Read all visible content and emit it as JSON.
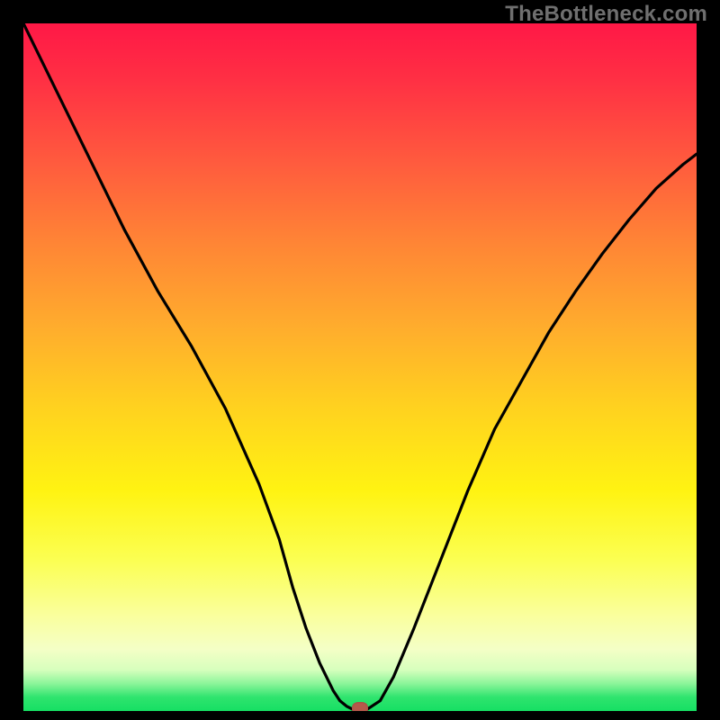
{
  "watermark": {
    "text": "TheBottleneck.com"
  },
  "colors": {
    "background": "#000000",
    "curve_stroke": "#000000",
    "marker_fill": "#b6594b",
    "gradient_top": "#ff1846",
    "gradient_bottom": "#16df63"
  },
  "chart_data": {
    "type": "line",
    "title": "",
    "xlabel": "",
    "ylabel": "",
    "xlim": [
      0,
      100
    ],
    "ylim": [
      0,
      100
    ],
    "grid": false,
    "legend": false,
    "x": [
      0,
      5,
      10,
      15,
      20,
      25,
      30,
      35,
      38,
      40,
      42,
      44,
      46,
      47,
      48,
      49,
      49.5,
      50,
      51,
      53,
      55,
      58,
      62,
      66,
      70,
      74,
      78,
      82,
      86,
      90,
      94,
      98,
      100
    ],
    "values": [
      100,
      90,
      80,
      70,
      61,
      53,
      44,
      33,
      25,
      18,
      12,
      7,
      3,
      1.5,
      0.7,
      0.2,
      0,
      0,
      0.2,
      1.5,
      5,
      12,
      22,
      32,
      41,
      48,
      55,
      61,
      66.5,
      71.5,
      76,
      79.5,
      81
    ],
    "marker": {
      "x": 50,
      "y": 0
    }
  }
}
